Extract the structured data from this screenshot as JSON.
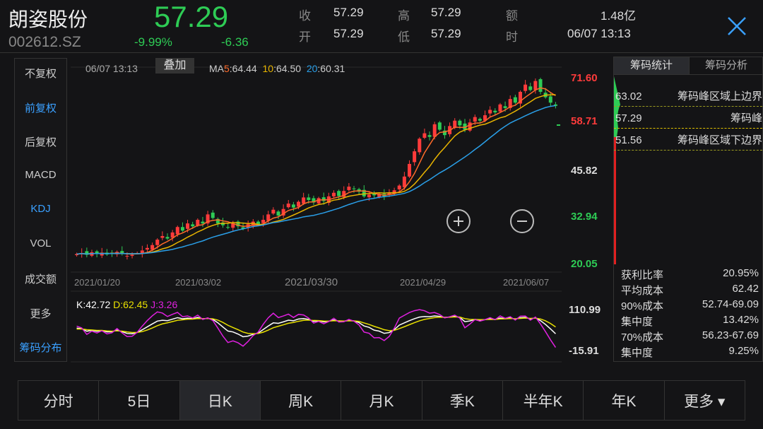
{
  "header": {
    "name": "朗姿股份",
    "code": "002612.SZ",
    "price": "57.29",
    "pct": "-9.99%",
    "change": "-6.36",
    "quote": [
      {
        "label": "收",
        "value": "57.29"
      },
      {
        "label": "开",
        "value": "57.29"
      },
      {
        "label": "高",
        "value": "57.29"
      },
      {
        "label": "低",
        "value": "57.29"
      },
      {
        "label": "额",
        "value": "1.48亿"
      },
      {
        "label": "时",
        "value": "06/07 13:13"
      }
    ]
  },
  "left_menu": [
    {
      "label": "不复权"
    },
    {
      "label": "前复权",
      "active": true
    },
    {
      "label": "后复权"
    },
    {
      "label": "MACD"
    },
    {
      "label": "KDJ",
      "active": true
    },
    {
      "label": "VOL"
    },
    {
      "label": "成交额"
    },
    {
      "label": "更多"
    },
    {
      "label": "筹码分布",
      "active": true
    }
  ],
  "chart": {
    "time": "06/07 13:13",
    "overlay": "叠加",
    "ma5_label": "MA",
    "ma5_n": "5",
    "ma5_v": ":64.44",
    "ma10_n": "10",
    "ma10_v": ":64.50",
    "ma20_n": "20",
    "ma20_v": ":60.31",
    "y_labels": [
      "71.60",
      "58.71",
      "45.82",
      "32.94",
      "20.05"
    ],
    "y_max": 71.6,
    "y_min": 20.05,
    "dates": [
      "2021/01/20",
      "2021/03/02",
      "2021/03/30",
      "2021/04/29",
      "2021/06/07"
    ],
    "kdj_k": "K:42.72",
    "kdj_d": "D:62.45",
    "kdj_j": "J:3.26",
    "kdj_top": "110.99",
    "kdj_bottom": "-15.91",
    "colors": {
      "up": "#ff3b3b",
      "down": "#2ecc55",
      "ma5": "#ff6a2a",
      "ma10": "#e8b400",
      "ma20": "#2a9fe8",
      "k": "#ffffff",
      "d": "#e8e000",
      "j": "#e020e0"
    },
    "closes": [
      22.5,
      22.8,
      22.3,
      23,
      22.6,
      22.9,
      22.4,
      22.7,
      23.1,
      22.5,
      22,
      22.3,
      22.8,
      23.5,
      24.2,
      25,
      26.5,
      27.5,
      26.8,
      28.5,
      30,
      29,
      31,
      30.2,
      32,
      31,
      33.5,
      32.5,
      31,
      30.5,
      29.8,
      31,
      30.2,
      29.5,
      30.8,
      31.5,
      30.6,
      32,
      33.5,
      34.8,
      33.2,
      35,
      36.5,
      35.4,
      37,
      38.2,
      37.5,
      36.8,
      38,
      37.2,
      38.5,
      39.5,
      38.6,
      40,
      41.2,
      40.5,
      39.8,
      38.5,
      39,
      38.8,
      39.2,
      38.5,
      39.5,
      40.2,
      41.5,
      44,
      47.5,
      51,
      54.5,
      56,
      55,
      58.5,
      57,
      55.5,
      58,
      59.5,
      58.2,
      57,
      59,
      60.5,
      59.5,
      61,
      62.5,
      61.8,
      64,
      63,
      65.5,
      64.5,
      67.5,
      69.5,
      68,
      70.5,
      67.5,
      66,
      64.5,
      63.6
    ]
  },
  "chips": {
    "tabs": [
      "筹码统计",
      "筹码分析"
    ],
    "rows": [
      {
        "value": "63.02",
        "label": "筹码峰区域上边界"
      },
      {
        "value": "57.29",
        "label": "筹码峰"
      },
      {
        "value": "51.56",
        "label": "筹码峰区域下边界"
      }
    ],
    "stats": [
      {
        "label": "获利比率",
        "value": "20.95%"
      },
      {
        "label": "平均成本",
        "value": "62.42"
      },
      {
        "label": "90%成本",
        "value": "52.74-69.09"
      },
      {
        "label": "集中度",
        "value": "13.42%"
      },
      {
        "label": "70%成本",
        "value": "56.23-67.69"
      },
      {
        "label": "集中度",
        "value": "9.25%"
      }
    ]
  },
  "periods": [
    {
      "label": "分时"
    },
    {
      "label": "5日"
    },
    {
      "label": "日K",
      "active": true
    },
    {
      "label": "周K"
    },
    {
      "label": "月K"
    },
    {
      "label": "季K"
    },
    {
      "label": "半年K"
    },
    {
      "label": "年K"
    },
    {
      "label": "更多 ▾"
    }
  ]
}
